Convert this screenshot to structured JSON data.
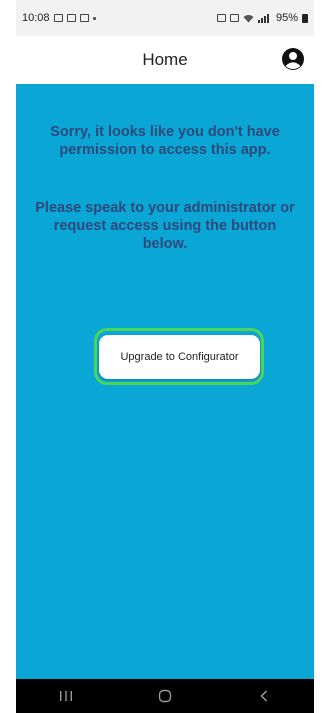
{
  "status_bar": {
    "time": "10:08",
    "battery": "95%"
  },
  "header": {
    "title": "Home",
    "profile_icon": "account-circle-icon"
  },
  "main": {
    "message_1": "Sorry, it looks like you don't have permission to access this app.",
    "message_2": "Please speak to your administrator or request access using the button below.",
    "upgrade_button_label": "Upgrade to Configurator"
  },
  "nav_bar": {
    "icons": [
      "recent-apps-icon",
      "home-icon",
      "back-icon"
    ]
  },
  "colors": {
    "background": "#0aa6d6",
    "message_text": "#2d4a7a",
    "highlight": "#4cd55a"
  }
}
